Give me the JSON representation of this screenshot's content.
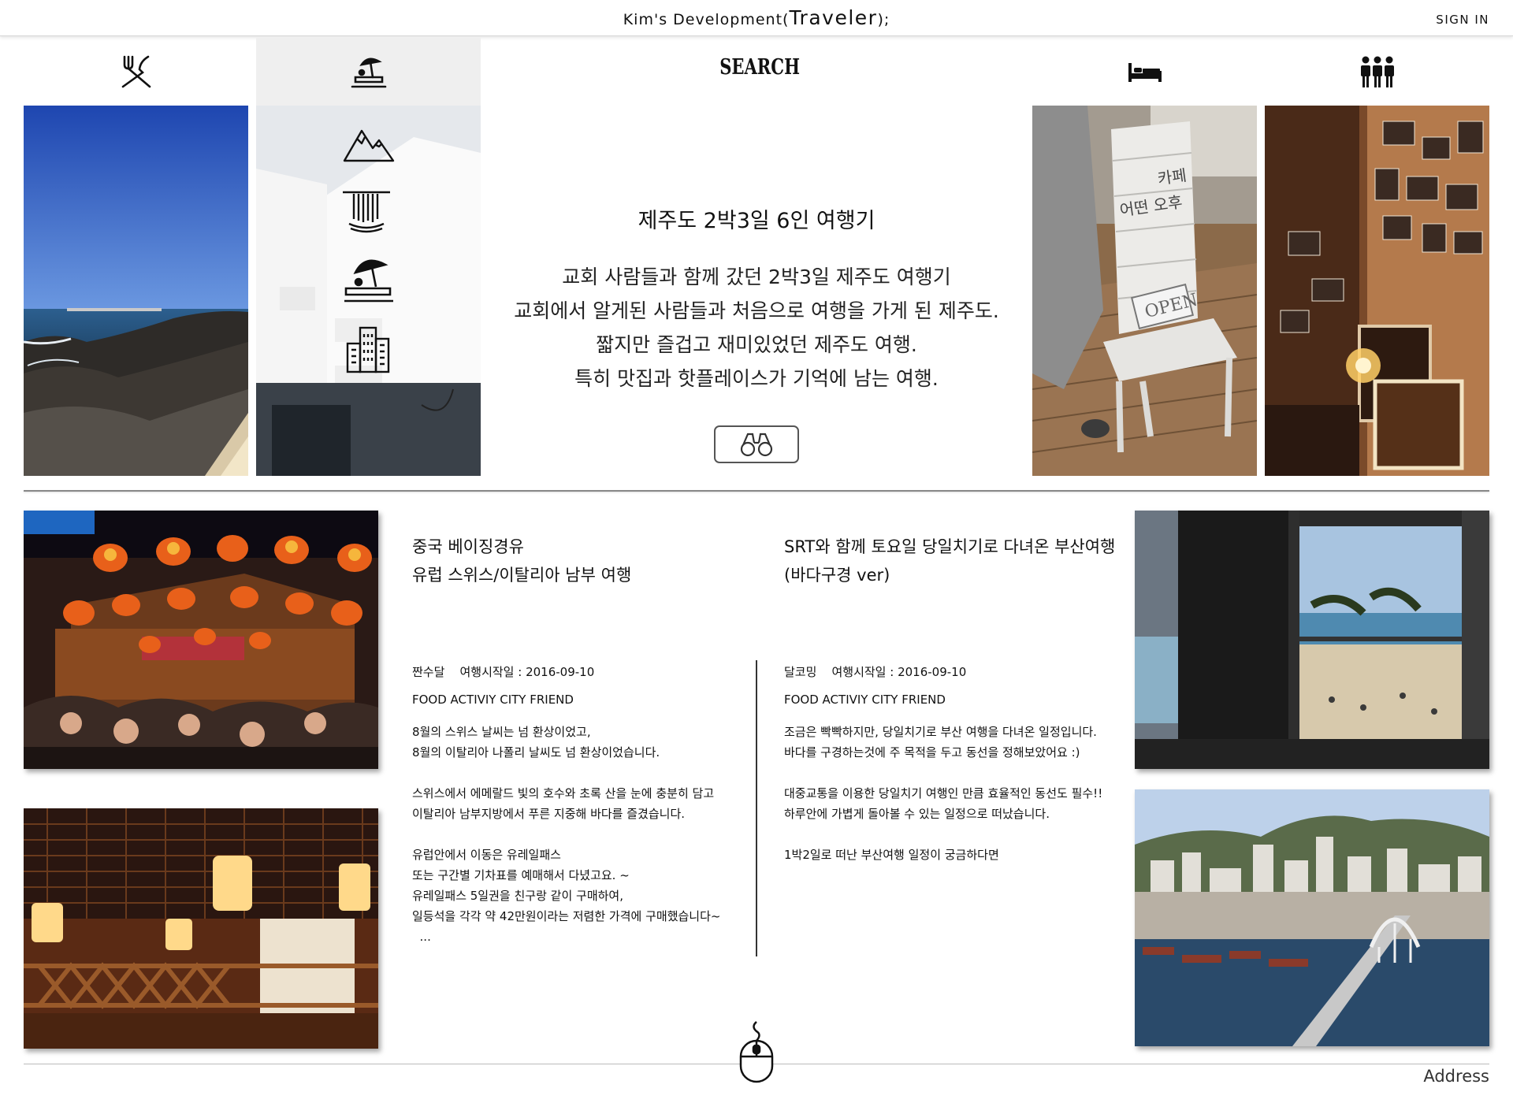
{
  "header": {
    "title_prefix": "Kim's Development(",
    "title_main": "Traveler",
    "title_suffix": ");",
    "sign_in": "SIGN IN"
  },
  "nav": {
    "icons": [
      "fork-knife-icon",
      "beach-umbrella-icon",
      "bed-icon",
      "group-icon"
    ],
    "search_label": "SEARCH",
    "active_index": 1
  },
  "hero": {
    "title": "제주도 2박3일 6인 여행기",
    "lines": [
      "교회 사람들과 함께 갔던 2박3일 제주도 여행기",
      "교회에서 알게된 사람들과 처음으로 여행을 가게 된 제주도.",
      "짧지만 즐겁고 재미있었던 제주도 여행.",
      "특히 맛집과 핫플레이스가 기억에 남는 여행."
    ],
    "category_icons": [
      "mountain-icon",
      "waterfall-icon",
      "beach-icon",
      "city-icon"
    ],
    "cafe_sign": [
      "카페",
      "어떤 오후"
    ],
    "open_sign": "OPEN"
  },
  "posts": [
    {
      "title_lines": [
        "중국 베이징경유",
        "유럽 스위스/이탈리아 남부 여행"
      ],
      "author": "짠수달",
      "date_label": "여행시작일 : 2016-09-10",
      "tags": "FOOD ACTIVIY CITY FRIEND",
      "paragraphs": [
        [
          "8월의 스위스 날씨는 넘 환상이었고,",
          "8월의 이탈리아 나폴리 날씨도 넘 환상이었습니다."
        ],
        [
          "스위스에서 에메랄드 빛의 호수와 초록 산을 눈에 충분히 담고",
          "이탈리아 남부지방에서 푸른 지중해 바다를 즐겼습니다."
        ],
        [
          "유럽안에서 이동은 유레일패스",
          "또는 구간별 기차표를 예매해서 다녔고요. ~",
          "유레일패스 5일권을 친구랑 같이 구매하여,",
          "일등석을 각각 약 42만원이라는 저렴한 가격에 구매했습니다~",
          "  ..."
        ]
      ]
    },
    {
      "title_lines": [
        "SRT와 함께 토요일 당일치기로 다녀온 부산여행",
        "(바다구경 ver)"
      ],
      "author": "달코밍",
      "date_label": "여행시작일 : 2016-09-10",
      "tags": "FOOD ACTIVIY CITY FRIEND",
      "paragraphs": [
        [
          "조금은 빡빡하지만, 당일치기로 부산 여행을 다녀온 일정입니다.",
          "바다를 구경하는것에 주 목적을 두고 동선을 정해보았어요 :)"
        ],
        [
          "대중교통을 이용한 당일치기 여행인 만큼 효율적인 동선도 필수!!",
          "하루안에 가볍게 돌아볼 수 있는 일정으로 떠났습니다."
        ],
        [
          "1박2일로 떠난 부산여행 일정이 궁금하다면"
        ]
      ]
    }
  ],
  "footer": {
    "address": "Address",
    "scroll_icon": "mouse-scroll-icon"
  },
  "colors": {
    "sky_blue": "#1f4fb3",
    "text": "#111111",
    "divider": "#888888",
    "active_nav": "#efefef"
  }
}
